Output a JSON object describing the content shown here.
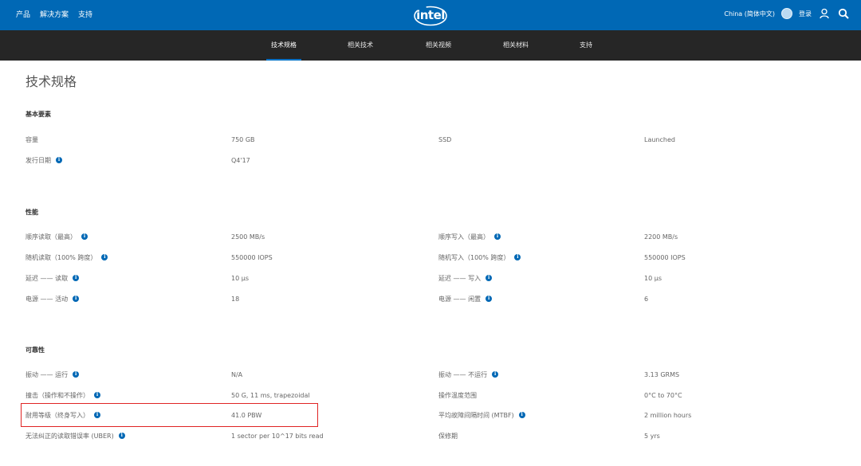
{
  "top_nav": [
    "产品",
    "解决方案",
    "支持"
  ],
  "logo_text": "intel",
  "region": "China (简体中文)",
  "login": "登录",
  "sub_nav": [
    {
      "label": "技术规格",
      "active": true
    },
    {
      "label": "相关技术",
      "active": false
    },
    {
      "label": "相关视频",
      "active": false
    },
    {
      "label": "相关材料",
      "active": false
    },
    {
      "label": "支持",
      "active": false
    }
  ],
  "page_title": "技术规格",
  "sections": {
    "essentials": {
      "title": "基本要素",
      "rows": [
        {
          "l_label": "容量",
          "l_value": "750 GB",
          "r_label": "SSD",
          "r_value": "Launched"
        },
        {
          "l_label": "发行日期",
          "l_value": "Q4'17"
        }
      ]
    },
    "performance": {
      "title": "性能",
      "rows": [
        {
          "l_label": "顺序读取（最高）",
          "l_value": "2500 MB/s",
          "r_label": "顺序写入（最高）",
          "r_value": "2200 MB/s"
        },
        {
          "l_label": "随机读取（100% 跨度）",
          "l_value": "550000 IOPS",
          "r_label": "随机写入（100% 跨度）",
          "r_value": "550000 IOPS"
        },
        {
          "l_label": "延迟 —— 读取",
          "l_value": "10 μs",
          "r_label": "延迟 —— 写入",
          "r_value": "10 μs"
        },
        {
          "l_label": "电源 —— 活动",
          "l_value": "18",
          "r_label": "电源 —— 闲置",
          "r_value": "6"
        }
      ]
    },
    "reliability": {
      "title": "可靠性",
      "rows": [
        {
          "l_label": "振动 —— 运行",
          "l_value": "N/A",
          "r_label": "振动 —— 不运行",
          "r_value": "3.13 GRMS"
        },
        {
          "l_label": "撞击（操作和不操作）",
          "l_value": "50 G, 11 ms, trapezoidal",
          "r_label": "操作温度范围",
          "r_value": "0°C to 70°C"
        },
        {
          "l_label": "耐用等级（终身写入）",
          "l_value": "41.0 PBW",
          "r_label": "平均故障间隔时间 (MTBF)",
          "r_value": "2 million hours"
        },
        {
          "l_label": "无法纠正的读取错误率 (UBER)",
          "l_value": "1 sector per 10^17 bits read",
          "r_label": "保修期",
          "r_value": "5 yrs"
        }
      ]
    }
  },
  "colors": {
    "brand_blue": "#0068b5",
    "nav_dark": "#262626",
    "highlight_red": "#e02424"
  },
  "icons": [
    "user-icon",
    "search-icon",
    "globe-icon",
    "info-icon"
  ]
}
